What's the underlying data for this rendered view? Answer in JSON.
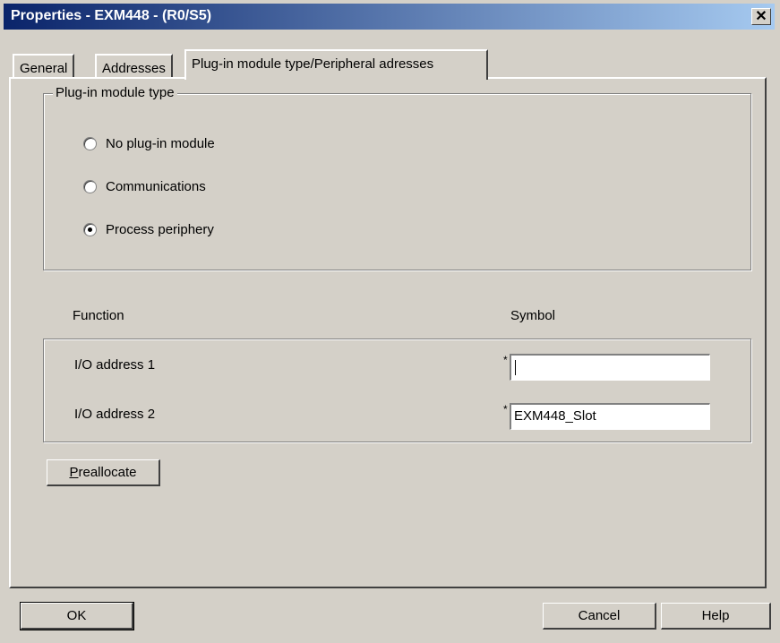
{
  "window": {
    "title": "Properties - EXM448 - (R0/S5)",
    "close_glyph": "✕"
  },
  "tabs": [
    {
      "label": "General"
    },
    {
      "label": "Addresses"
    },
    {
      "label": "Plug-in module type/Peripheral adresses"
    }
  ],
  "plugin_group": {
    "legend": "Plug-in module type",
    "options": [
      {
        "label": "No plug-in module",
        "selected": false
      },
      {
        "label": "Communications",
        "selected": false
      },
      {
        "label": "Process periphery",
        "selected": true
      }
    ]
  },
  "address_table": {
    "function_header": "Function",
    "symbol_header": "Symbol",
    "rows": [
      {
        "label": "I/O address 1",
        "marker": "*",
        "value": ""
      },
      {
        "label": "I/O address 2",
        "marker": "*",
        "value": "EXM448_Slot"
      }
    ]
  },
  "preallocate_button": {
    "mnemonic": "P",
    "rest": "reallocate"
  },
  "footer": {
    "ok_label": "OK",
    "cancel_label": "Cancel",
    "help_label": "Help"
  }
}
